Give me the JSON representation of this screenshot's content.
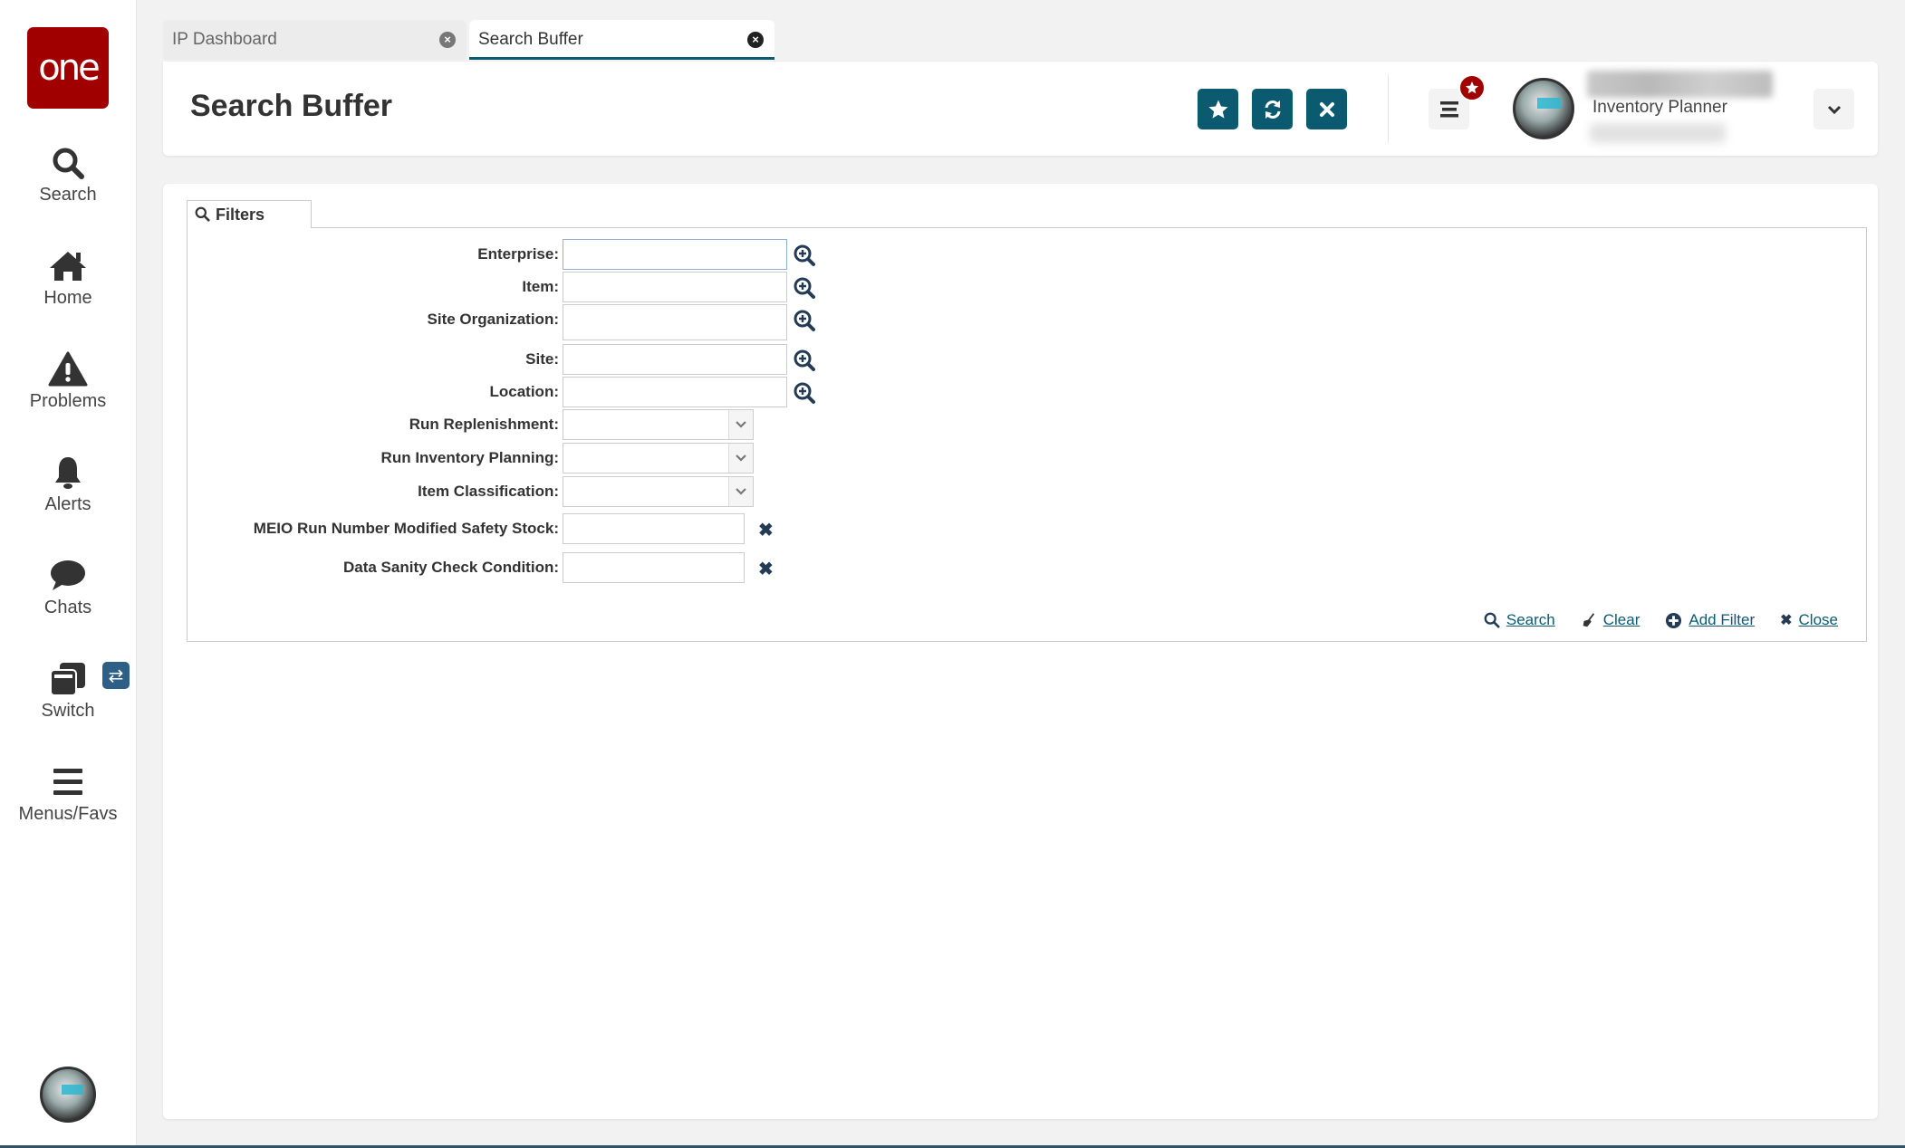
{
  "sidebar": {
    "logo_text": "one",
    "items": [
      {
        "label": "Search",
        "icon": "search-icon"
      },
      {
        "label": "Home",
        "icon": "home-icon"
      },
      {
        "label": "Problems",
        "icon": "warning-icon"
      },
      {
        "label": "Alerts",
        "icon": "bell-icon"
      },
      {
        "label": "Chats",
        "icon": "chat-icon"
      },
      {
        "label": "Switch",
        "icon": "windows-icon"
      },
      {
        "label": "Menus/Favs",
        "icon": "menu-icon"
      }
    ],
    "switch_badge": "⇄"
  },
  "tabs": [
    {
      "label": "IP Dashboard",
      "active": false
    },
    {
      "label": "Search Buffer",
      "active": true
    }
  ],
  "header": {
    "title": "Search Buffer",
    "buttons": [
      "favorite",
      "refresh",
      "close"
    ],
    "user_role": "Inventory Planner"
  },
  "filters": {
    "tab_label": "Filters",
    "fields": [
      {
        "label": "Enterprise:",
        "type": "lookup",
        "value": ""
      },
      {
        "label": "Item:",
        "type": "lookup",
        "value": ""
      },
      {
        "label": "Site Organization:",
        "type": "lookup",
        "value": ""
      },
      {
        "label": "Site:",
        "type": "lookup",
        "value": ""
      },
      {
        "label": "Location:",
        "type": "lookup",
        "value": ""
      },
      {
        "label": "Run Replenishment:",
        "type": "select",
        "value": ""
      },
      {
        "label": "Run Inventory Planning:",
        "type": "select",
        "value": ""
      },
      {
        "label": "Item Classification:",
        "type": "select",
        "value": ""
      },
      {
        "label": "MEIO Run Number Modified Safety Stock:",
        "type": "text-clear",
        "value": ""
      },
      {
        "label": "Data Sanity Check Condition:",
        "type": "text-clear",
        "value": ""
      }
    ],
    "actions": {
      "search": "Search",
      "clear": "Clear",
      "add_filter": "Add Filter",
      "close": "Close"
    }
  },
  "colors": {
    "brand_red": "#a00000",
    "accent_teal": "#0b5a70",
    "switch_blue": "#2e5f86"
  }
}
